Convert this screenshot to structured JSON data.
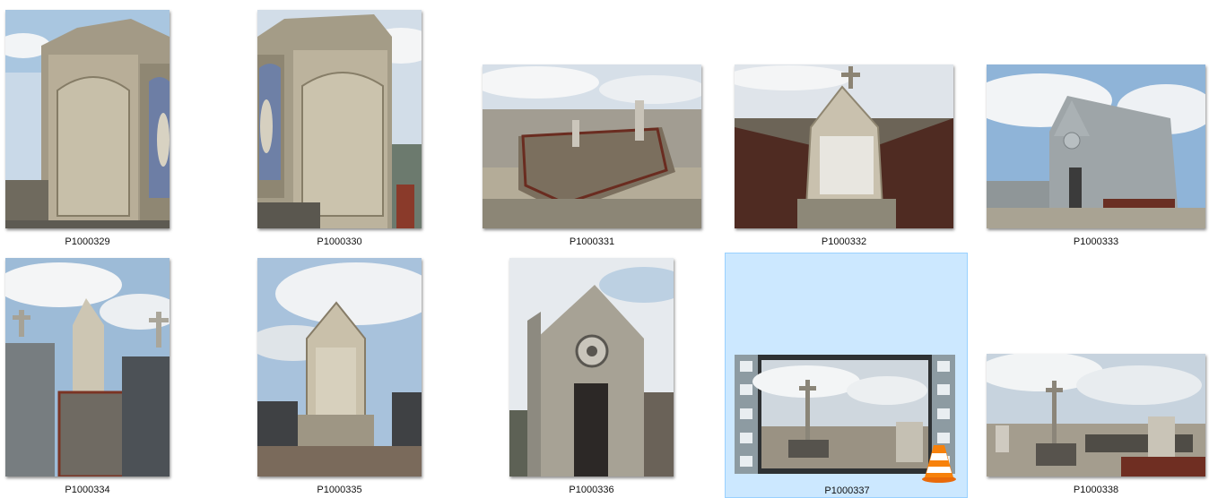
{
  "view": "large-icons",
  "selection_color": "#cce8ff",
  "items": [
    {
      "name": "P1000329",
      "type": "photo",
      "orientation": "portrait",
      "subject": "grave-stele-with-niche-statue"
    },
    {
      "name": "P1000330",
      "type": "photo",
      "orientation": "portrait",
      "subject": "grave-stele-with-niche-statue"
    },
    {
      "name": "P1000331",
      "type": "photo",
      "orientation": "landscape",
      "subject": "cemetery-iron-railings"
    },
    {
      "name": "P1000332",
      "type": "photo",
      "orientation": "landscape",
      "subject": "gabled-headstone-with-cross"
    },
    {
      "name": "P1000333",
      "type": "photo",
      "orientation": "landscape",
      "subject": "chapel-mausoleum"
    },
    {
      "name": "P1000334",
      "type": "photo",
      "orientation": "portrait",
      "subject": "cemetery-crosses"
    },
    {
      "name": "P1000335",
      "type": "photo",
      "orientation": "portrait",
      "subject": "gothic-stele"
    },
    {
      "name": "P1000336",
      "type": "photo",
      "orientation": "portrait",
      "subject": "chapel-rose-window"
    },
    {
      "name": "P1000337",
      "type": "video",
      "orientation": "landscape",
      "subject": "cemetery-cross-panorama",
      "overlay_icon": "vlc-cone-icon",
      "selected": true
    },
    {
      "name": "P1000338",
      "type": "photo",
      "orientation": "landscape",
      "subject": "cemetery-cross-panorama"
    }
  ]
}
